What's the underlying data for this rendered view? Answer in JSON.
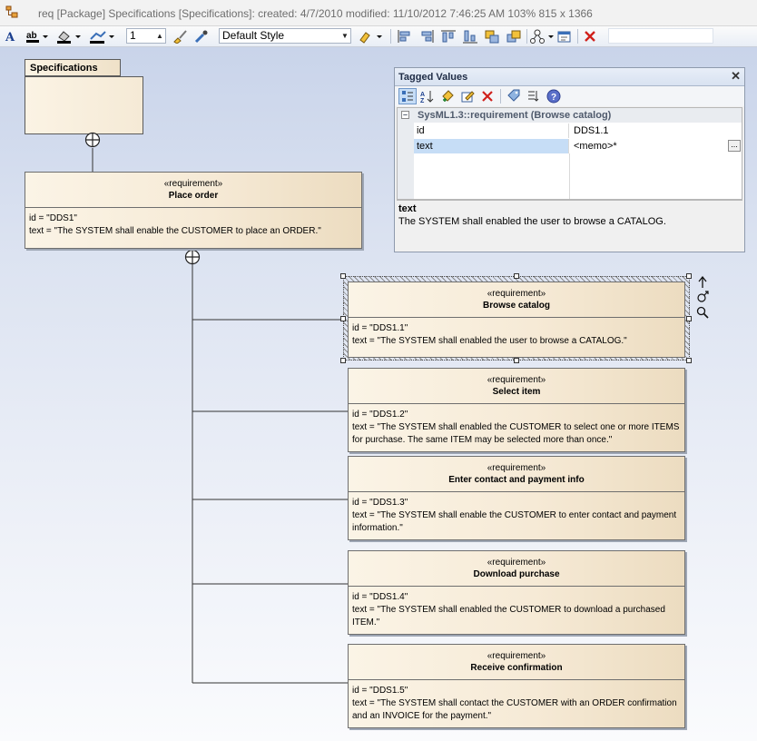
{
  "window": {
    "title": "req [Package] Specifications [Specifications]:  created: 4/7/2010  modified: 11/10/2012 7:46:25 AM   103%   815 x 1366"
  },
  "toolbar": {
    "line_width": "1",
    "style_select": "Default Style"
  },
  "package": {
    "name": "Specifications"
  },
  "requirements": [
    {
      "stereotype": "«requirement»",
      "name": "Place order",
      "id_line": "id = \"DDS1\"",
      "text_line": "text = \"The SYSTEM shall enable the CUSTOMER to place an ORDER.\""
    },
    {
      "stereotype": "«requirement»",
      "name": "Browse catalog",
      "id_line": "id = \"DDS1.1\"",
      "text_line": "text = \"The SYSTEM shall enabled the user to browse a CATALOG.\""
    },
    {
      "stereotype": "«requirement»",
      "name": "Select item",
      "id_line": "id = \"DDS1.2\"",
      "text_line": "text = \"The SYSTEM shall enabled the CUSTOMER to select one or more ITEMS for purchase.  The same ITEM may be selected more than once.\""
    },
    {
      "stereotype": "«requirement»",
      "name": "Enter contact and payment info",
      "id_line": "id = \"DDS1.3\"",
      "text_line": "text = \"The SYSTEM shall enable the CUSTOMER to enter contact and payment information.\""
    },
    {
      "stereotype": "«requirement»",
      "name": "Download purchase",
      "id_line": "id = \"DDS1.4\"",
      "text_line": "text = \"The SYSTEM shall enabled the CUSTOMER to download a purchased ITEM.\""
    },
    {
      "stereotype": "«requirement»",
      "name": "Receive confirmation",
      "id_line": "id = \"DDS1.5\"",
      "text_line": "text = \"The SYSTEM shall contact the CUSTOMER with an ORDER confirmation and an INVOICE for the payment.\""
    }
  ],
  "tagged_values": {
    "title": "Tagged Values",
    "category": "SysML1.3::requirement (Browse catalog)",
    "rows": [
      {
        "key": "id",
        "value": "DDS1.1"
      },
      {
        "key": "text",
        "value": "<memo>*"
      }
    ],
    "desc_heading": "text",
    "desc_body": "The SYSTEM shall enabled the user to browse a CATALOG."
  },
  "colors": {
    "canvas_top": "#c9d4ea",
    "element_fill": "#f6ead6",
    "selection_row": "#c6ddf6"
  },
  "icons": [
    "diagram-icon",
    "font-icon",
    "font-color-icon",
    "fill-color-icon",
    "line-color-icon",
    "paintbrush-icon",
    "eyedropper-icon",
    "highlighter-icon",
    "align-icon",
    "delete-icon",
    "close-icon",
    "move-arrow-icon",
    "link-icon",
    "zoom-icon"
  ]
}
